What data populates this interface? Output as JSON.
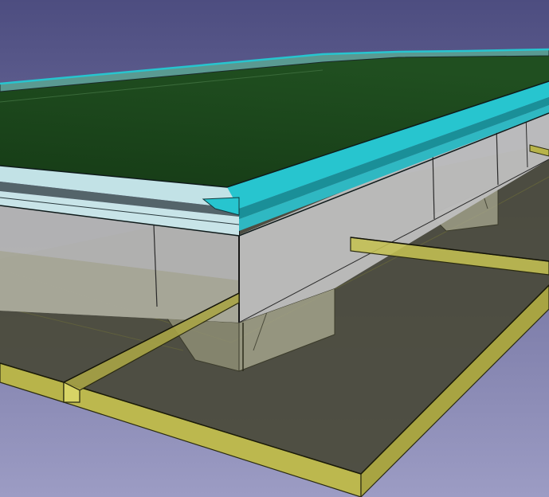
{
  "viewport": {
    "view": "3D model view",
    "background": {
      "top": "#4d4d80",
      "bottom": "#9c9cc4"
    }
  },
  "colors": {
    "edge": "#161616",
    "slab_face": "#4a4a3c",
    "slab_side": "#bcb84e",
    "slab_edge": "#3a3a14",
    "beam_top": "#a8a446",
    "beam_side": "#d8d466",
    "support_face": "#a2a28a",
    "wall_face": "#b4b4b4",
    "wall_shade": "#cacaca",
    "trim_light": "#c2e2e6",
    "trim_dark": "#54646a",
    "trim_cyan": "#27c5cf",
    "trim_cyan_dark": "#1a8f98",
    "roof": "#163b16",
    "roof_far": "#204f20",
    "parapet": "#5a9a92"
  },
  "model_parts": [
    {
      "name": "floor-slab",
      "material": "translucent-yellow"
    },
    {
      "name": "beam",
      "material": "translucent-yellow"
    },
    {
      "name": "support-block",
      "material": "translucent-grey"
    },
    {
      "name": "wall",
      "material": "grey"
    },
    {
      "name": "roof-trim",
      "material": "cyan"
    },
    {
      "name": "roof-surface",
      "material": "dark-green"
    }
  ]
}
